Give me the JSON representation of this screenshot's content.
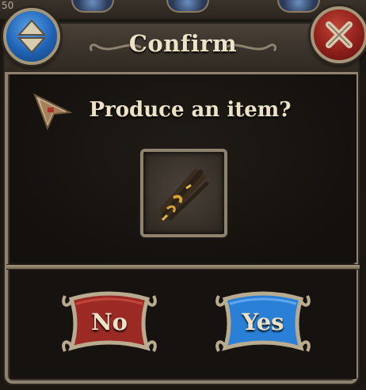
{
  "dialog": {
    "title": "Confirm",
    "question": "Produce an item?",
    "item_icon": "bundle-of-sticks-icon"
  },
  "buttons": {
    "no_label": "No",
    "yes_label": "Yes",
    "sort_icon": "up-down-arrows-icon",
    "close_icon": "close-x-icon"
  },
  "top_strip": {
    "partial_text": "50"
  },
  "colors": {
    "frame": "#8f836f",
    "panel_bg": "#1a1612",
    "text": "#ece2c7",
    "no_button": "#9b2a25",
    "yes_button": "#2a7fd6",
    "close_button": "#8e1f1a",
    "sort_button": "#1f62b3"
  }
}
